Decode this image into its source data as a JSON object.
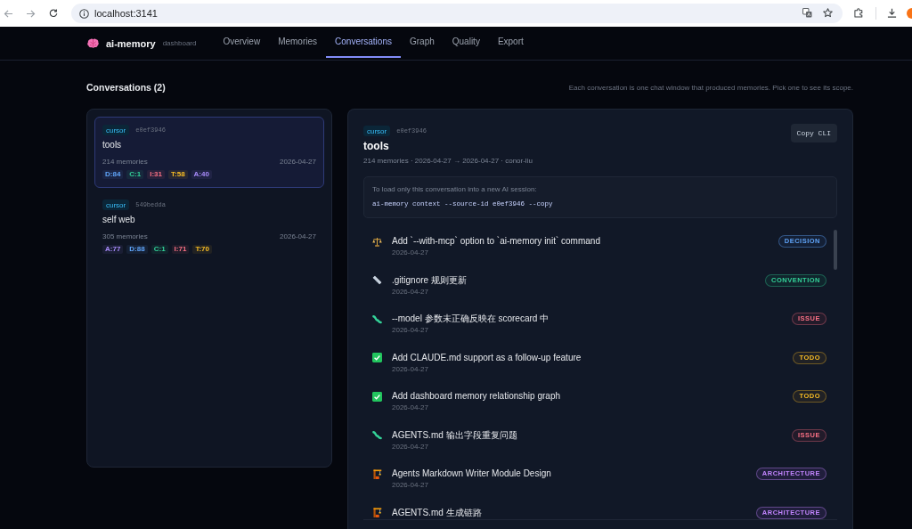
{
  "browser": {
    "address": "localhost:3141"
  },
  "header": {
    "logo": "ai-memory",
    "subtitle": "dashboard",
    "tabs": [
      {
        "label": "Overview",
        "selected": false
      },
      {
        "label": "Memories",
        "selected": false
      },
      {
        "label": "Conversations",
        "selected": true
      },
      {
        "label": "Graph",
        "selected": false
      },
      {
        "label": "Quality",
        "selected": false
      },
      {
        "label": "Export",
        "selected": false
      }
    ]
  },
  "page": {
    "heading": "Conversations (2)",
    "description": "Each conversation is one chat window that produced memories. Pick one to see its scope."
  },
  "conversations": [
    {
      "source": "cursor",
      "hash": "e0ef3946",
      "title": "tools",
      "count": "214 memories",
      "date": "2026-04-27",
      "selected": true,
      "chips": [
        {
          "label": "D:84",
          "color": "#60a5fa"
        },
        {
          "label": "C:1",
          "color": "#34d399"
        },
        {
          "label": "I:31",
          "color": "#fb7185"
        },
        {
          "label": "T:58",
          "color": "#fbbf24"
        },
        {
          "label": "A:40",
          "color": "#a78bfa"
        }
      ]
    },
    {
      "source": "cursor",
      "hash": "549bedda",
      "title": "self web",
      "count": "305 memories",
      "date": "2026-04-27",
      "selected": false,
      "chips": [
        {
          "label": "A:77",
          "color": "#a78bfa"
        },
        {
          "label": "D:88",
          "color": "#60a5fa"
        },
        {
          "label": "C:1",
          "color": "#34d399"
        },
        {
          "label": "I:71",
          "color": "#fb7185"
        },
        {
          "label": "T:70",
          "color": "#fbbf24"
        }
      ]
    }
  ],
  "detail": {
    "source": "cursor",
    "hash": "e0ef3946",
    "title": "tools",
    "meta": "214 memories · 2026-04-27 → 2026-04-27 · conor-liu",
    "copy_button": "Copy CLI",
    "hint": "To load only this conversation into a new AI session:",
    "command": "ai-memory context --source-id e0ef3946 --copy",
    "memories": [
      {
        "kind": "decision",
        "title": "Add `--with-mcp` option to `ai-memory init` command",
        "date": "2026-04-27",
        "badge": "DECISION"
      },
      {
        "kind": "convention",
        "title": ".gitignore 规则更新",
        "date": "2026-04-27",
        "badge": "CONVENTION"
      },
      {
        "kind": "issue",
        "title": "--model 参数未正确反映在 scorecard 中",
        "date": "2026-04-27",
        "badge": "ISSUE"
      },
      {
        "kind": "todo",
        "title": "Add CLAUDE.md support as a follow-up feature",
        "date": "2026-04-27",
        "badge": "TODO"
      },
      {
        "kind": "todo",
        "title": "Add dashboard memory relationship graph",
        "date": "2026-04-27",
        "badge": "TODO"
      },
      {
        "kind": "issue",
        "title": "AGENTS.md 输出字段重复问题",
        "date": "2026-04-27",
        "badge": "ISSUE"
      },
      {
        "kind": "architecture",
        "title": "Agents Markdown Writer Module Design",
        "date": "2026-04-27",
        "badge": "ARCHITECTURE"
      },
      {
        "kind": "architecture",
        "title": "AGENTS.md 生成链路",
        "badge": "ARCHITECTURE"
      }
    ]
  }
}
